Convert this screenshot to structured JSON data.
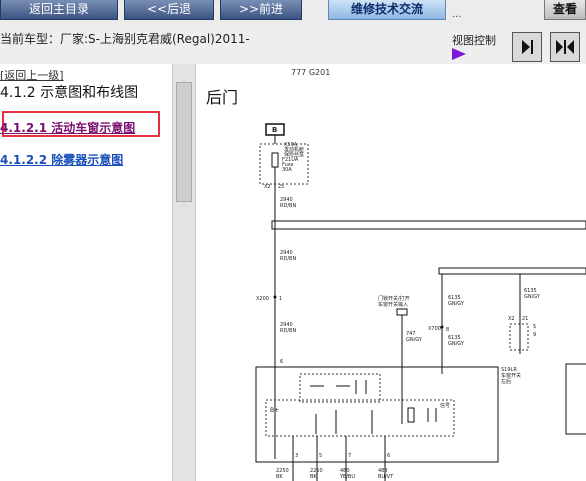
{
  "toolbar": {
    "back_main": "返回主目录",
    "prev": "<<后退",
    "next": ">>前进",
    "tech_exchange": "维修技术交流",
    "dots": "...",
    "view_partial": "查看"
  },
  "car_type": "当前车型：厂家:S-上海别克君威(Regal)2011-",
  "view_control_label": "视图控制",
  "sidebar": {
    "back_link": "[返回上一级]",
    "section_title": "4.1.2 示意图和布线图",
    "items": [
      {
        "label": "4.1.2.1 活动车窗示意图",
        "active": true
      },
      {
        "label": "4.1.2.2 除雾器示意图",
        "active": false
      }
    ]
  },
  "main": {
    "title": "后门",
    "sig_code": "777 G201",
    "diagram_labels": {
      "fuse_box_id": "B",
      "fuse_text1": "X50A",
      "fuse_text2": "发动机舱",
      "fuse_text3": "保险丝盒",
      "fuse_name": "F21UA",
      "fuse_sub": "Fuse",
      "fuse_amp": "30A",
      "conn_x2": "X2",
      "conn_pin25": "25",
      "w1_code": "2940",
      "w1_color": "RD/BN",
      "w2_code": "2940",
      "w2_color": "RD/BN",
      "x200": "X200",
      "pin1": "1",
      "w3_code": "2940",
      "w3_color": "RD/BN",
      "w4_note1": "门锁开关/打开",
      "w4_note2": "车窗开关输入",
      "w5_code": "747",
      "w5_color": "GN/GY",
      "w6_code": "6135",
      "w6_color": "GN/GY",
      "x700": "X700",
      "pin8": "8",
      "w7_code": "6135",
      "w7_color": "GN/GY",
      "w8_code": "6135",
      "w8_color": "GN/GY",
      "x2b": "X2",
      "pin21": "21",
      "pin5": "5",
      "pin6": "6",
      "pin9": "9",
      "module_id": "S19LR",
      "module_name1": "车窗开关",
      "module_name2": "左后",
      "bplus": "B+",
      "sig_label": "信号",
      "bot_pin3": "3",
      "bot_pin5": "5",
      "bot_pin7": "7",
      "bot_pin6": "6",
      "bw1_code": "2250",
      "bw1_color": "BK",
      "bw2_code": "2250",
      "bw2_color": "BK",
      "bw3_code": "480",
      "bw3_color": "YE/BU",
      "bw4_code": "488",
      "bw4_color": "BU/VT"
    }
  },
  "colors": {
    "nav_blue": "#3c5484",
    "highlight_red": "#e0303a",
    "link_blue": "#1a4fbc",
    "active_purple": "#7a0f6f",
    "view_icon": "#7c18d8"
  }
}
